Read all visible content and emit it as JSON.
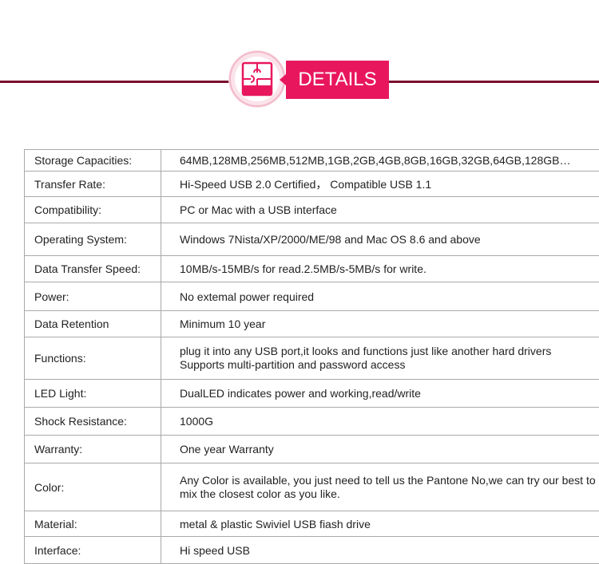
{
  "header": {
    "title": "DETAILS",
    "accent_color": "#e8175d",
    "line_color": "#7a0f2e",
    "icon": "puzzle-icon"
  },
  "specs": [
    {
      "label": "Storage Capacities:",
      "value": "64MB,128MB,256MB,512MB,1GB,2GB,4GB,8GB,16GB,32GB,64GB,128GB…"
    },
    {
      "label": "Transfer Rate:",
      "value": "Hi-Speed USB 2.0 Certified， Compatible USB 1.1"
    },
    {
      "label": "Compatibility:",
      "value": "PC or Mac with a USB interface"
    },
    {
      "label": "Operating System:",
      "value": "Windows 7Nista/XP/2000/ME/98 and Mac OS 8.6 and above"
    },
    {
      "label": "Data Transfer Speed:",
      "value": "10MB/s-15MB/s for read.2.5MB/s-5MB/s for write."
    },
    {
      "label": "Power:",
      "value": "No extemal power required"
    },
    {
      "label": "Data Retention",
      "value": "Minimum 10 year"
    },
    {
      "label": "Functions:",
      "lines": [
        "plug it into any USB port,it looks and functions just like another hard drivers",
        "Supports multi-partition and password access"
      ]
    },
    {
      "label": "LED Light:",
      "value": "DualLED indicates power and working,read/write"
    },
    {
      "label": "Shock Resistance:",
      "value": "1000G"
    },
    {
      "label": "Warranty:",
      "value": "One year Warranty"
    },
    {
      "label": "Color:",
      "lines": [
        "Any Color is available, you just need to tell us the Pantone No,we can try our best to",
        "mix the closest color as you like."
      ]
    },
    {
      "label": "Material:",
      "value": "metal & plastic Swiviel USB fiash drive"
    },
    {
      "label": "Interface:",
      "value": "Hi speed USB"
    }
  ]
}
